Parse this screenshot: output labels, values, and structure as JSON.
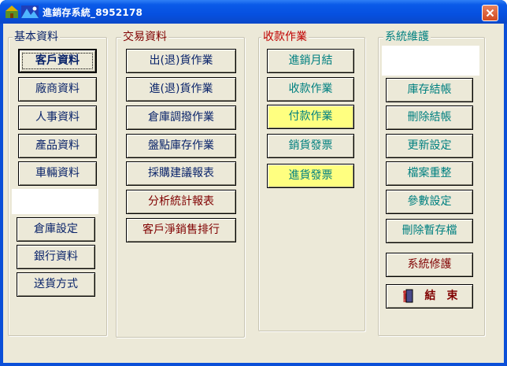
{
  "window": {
    "title": "進銷存系統_8952178"
  },
  "colors": {
    "navy": "#0a246a",
    "maroon": "#800000",
    "teal": "#008080",
    "red": "#c00000",
    "highlight": "#ffff80"
  },
  "groups": {
    "basic": {
      "label": "基本資料",
      "buttons": [
        "客戶資料",
        "廠商資料",
        "人事資料",
        "產品資料",
        "車輛資料",
        "倉庫設定",
        "銀行資料",
        "送貨方式"
      ]
    },
    "trade": {
      "label": "交易資料",
      "buttons": [
        "出(退)貨作業",
        "進(退)貨作業",
        "倉庫調撥作業",
        "盤點庫存作業",
        "採購建議報表",
        "分析統計報表",
        "客戶淨銷售排行"
      ]
    },
    "payment": {
      "label": "收款作業",
      "buttons": [
        "進銷月結",
        "收款作業",
        "付款作業",
        "銷貨發票",
        "進貨發票"
      ]
    },
    "system": {
      "label": "系統維護",
      "buttons": [
        "庫存結帳",
        "刪除結帳",
        "更新設定",
        "檔案重整",
        "參數設定",
        "刪除暫存檔",
        "系統修護",
        "結　束"
      ]
    }
  }
}
